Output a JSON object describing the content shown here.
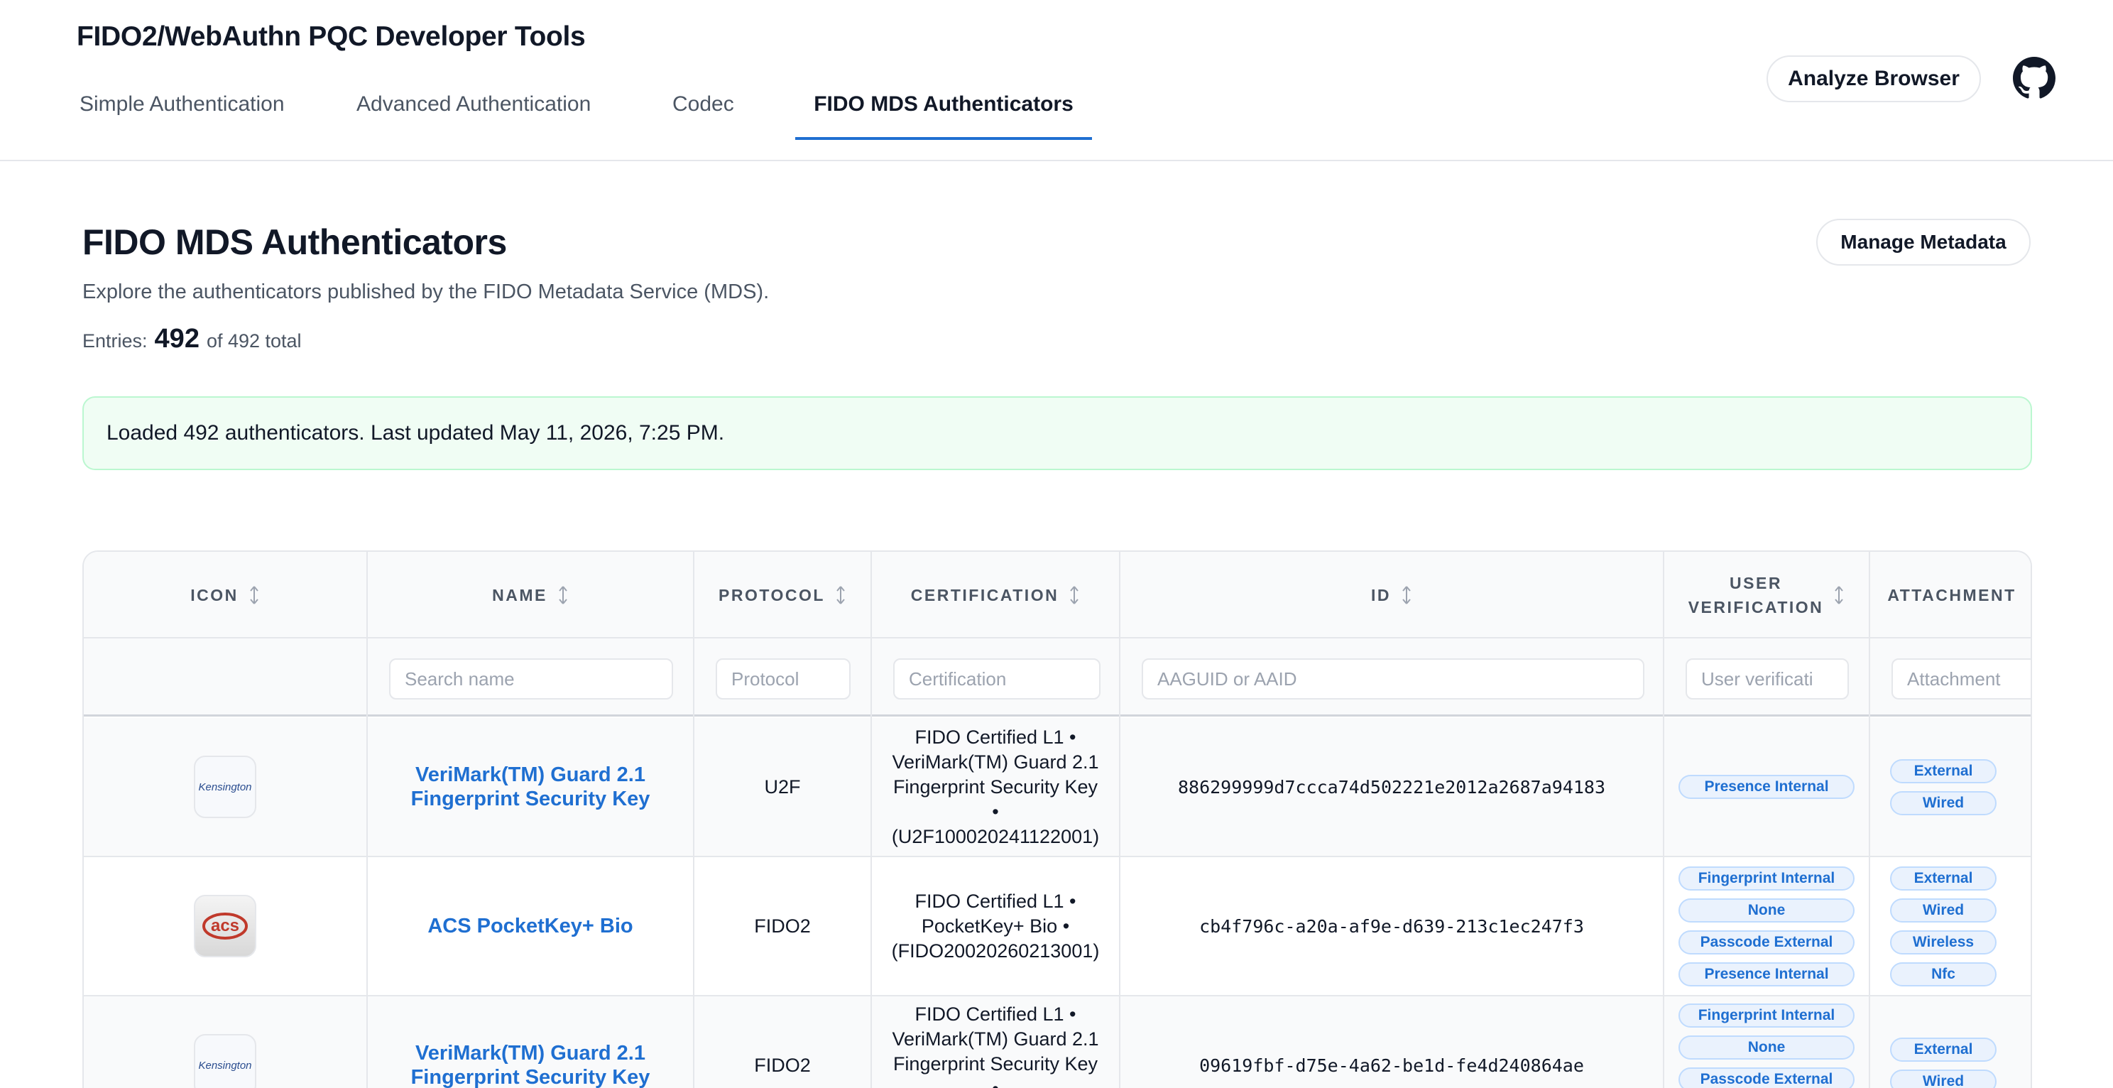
{
  "app": {
    "title": "FIDO2/WebAuthn PQC Developer Tools",
    "tabs": [
      {
        "label": "Simple Authentication"
      },
      {
        "label": "Advanced Authentication"
      },
      {
        "label": "Codec"
      },
      {
        "label": "FIDO MDS Authenticators"
      }
    ],
    "analyze_label": "Analyze Browser",
    "accent_color": "#1f6fd1"
  },
  "page": {
    "title": "FIDO MDS Authenticators",
    "subtitle": "Explore the authenticators published by the FIDO Metadata Service (MDS).",
    "entries_label": "Entries:",
    "entries_count": "492",
    "entries_total": "of 492 total",
    "manage_label": "Manage Metadata",
    "alert_text": "Loaded 492 authenticators. Last updated May 11, 2026, 7:25 PM."
  },
  "table": {
    "columns": [
      {
        "header": "ICON"
      },
      {
        "header": "NAME",
        "placeholder": "Search name"
      },
      {
        "header": "PROTOCOL",
        "placeholder": "Protocol"
      },
      {
        "header": "CERTIFICATION",
        "placeholder": "Certification"
      },
      {
        "header": "ID",
        "placeholder": "AAGUID or AAID"
      },
      {
        "header_line1": "USER",
        "header_line2": "VERIFICATION",
        "placeholder": "User verificati"
      },
      {
        "header": "ATTACHMENT",
        "placeholder": "Attachment"
      }
    ],
    "rows": [
      {
        "logo": "Kensington",
        "name_line1": "VeriMark(TM) Guard 2.1",
        "name_line2": "Fingerprint Security Key",
        "protocol": "U2F",
        "cert_lines": [
          "FIDO Certified L1 •",
          "VeriMark(TM) Guard 2.1",
          "Fingerprint Security Key",
          "•",
          "(U2F100020241122001)"
        ],
        "id": "886299999d7ccca74d502221e2012a2687a94183",
        "uv": [
          "Presence Internal"
        ],
        "attachment": [
          "External",
          "Wired"
        ]
      },
      {
        "logo": "acs",
        "name_line1": "ACS PocketKey+ Bio",
        "protocol": "FIDO2",
        "cert_lines": [
          "FIDO Certified L1 •",
          "PocketKey+ Bio •",
          "(FIDO20020260213001)"
        ],
        "id": "cb4f796c-a20a-af9e-d639-213c1ec247f3",
        "uv": [
          "Fingerprint Internal",
          "None",
          "Passcode External",
          "Presence Internal"
        ],
        "attachment": [
          "External",
          "Wired",
          "Wireless",
          "Nfc"
        ]
      },
      {
        "logo": "Kensington",
        "name_line1": "VeriMark(TM) Guard 2.1",
        "name_line2": "Fingerprint Security Key",
        "protocol": "FIDO2",
        "cert_lines": [
          "FIDO Certified L1 •",
          "VeriMark(TM) Guard 2.1",
          "Fingerprint Security Key",
          "•"
        ],
        "id": "09619fbf-d75e-4a62-be1d-fe4d240864ae",
        "uv": [
          "Fingerprint Internal",
          "None",
          "Passcode External"
        ],
        "attachment": [
          "External",
          "Wired"
        ]
      }
    ]
  }
}
